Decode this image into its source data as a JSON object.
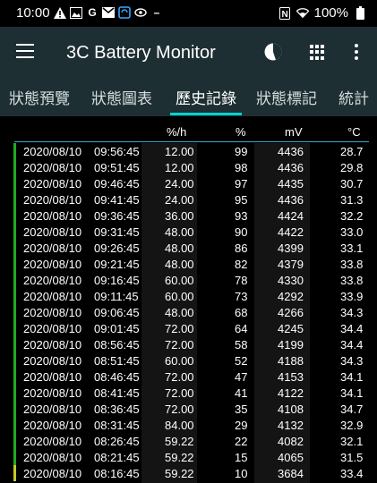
{
  "status_bar": {
    "time": "10:00",
    "battery": "100%",
    "left_icons": [
      "warning-icon",
      "image-icon",
      "google-icon",
      "gmail-icon",
      "sync-icon",
      "eye-icon",
      "dash-icon"
    ]
  },
  "app_bar": {
    "title": "3C Battery Monitor"
  },
  "tabs": [
    {
      "label": "狀態預覽",
      "active": false
    },
    {
      "label": "狀態圖表",
      "active": false
    },
    {
      "label": "歷史記錄",
      "active": true
    },
    {
      "label": "狀態標記",
      "active": false
    },
    {
      "label": "統計",
      "active": false
    }
  ],
  "table": {
    "headers": {
      "rate": "%/h",
      "pct": "%",
      "mv": "mV",
      "temp": "°C"
    },
    "rows": [
      {
        "date": "2020/08/10",
        "time": "09:56:45",
        "rate": "12.00",
        "pct": "99",
        "mv": "4436",
        "temp": "28.7",
        "status_color": "#1faa1f"
      },
      {
        "date": "2020/08/10",
        "time": "09:51:45",
        "rate": "12.00",
        "pct": "98",
        "mv": "4436",
        "temp": "29.8",
        "status_color": "#1faa1f"
      },
      {
        "date": "2020/08/10",
        "time": "09:46:45",
        "rate": "24.00",
        "pct": "97",
        "mv": "4435",
        "temp": "30.7",
        "status_color": "#1faa1f"
      },
      {
        "date": "2020/08/10",
        "time": "09:41:45",
        "rate": "24.00",
        "pct": "95",
        "mv": "4436",
        "temp": "31.3",
        "status_color": "#1faa1f"
      },
      {
        "date": "2020/08/10",
        "time": "09:36:45",
        "rate": "36.00",
        "pct": "93",
        "mv": "4424",
        "temp": "32.2",
        "status_color": "#1faa1f"
      },
      {
        "date": "2020/08/10",
        "time": "09:31:45",
        "rate": "48.00",
        "pct": "90",
        "mv": "4422",
        "temp": "33.0",
        "status_color": "#1faa1f"
      },
      {
        "date": "2020/08/10",
        "time": "09:26:45",
        "rate": "48.00",
        "pct": "86",
        "mv": "4399",
        "temp": "33.1",
        "status_color": "#1faa1f"
      },
      {
        "date": "2020/08/10",
        "time": "09:21:45",
        "rate": "48.00",
        "pct": "82",
        "mv": "4379",
        "temp": "33.8",
        "status_color": "#1faa1f"
      },
      {
        "date": "2020/08/10",
        "time": "09:16:45",
        "rate": "60.00",
        "pct": "78",
        "mv": "4330",
        "temp": "33.8",
        "status_color": "#1faa1f"
      },
      {
        "date": "2020/08/10",
        "time": "09:11:45",
        "rate": "60.00",
        "pct": "73",
        "mv": "4292",
        "temp": "33.9",
        "status_color": "#1faa1f"
      },
      {
        "date": "2020/08/10",
        "time": "09:06:45",
        "rate": "48.00",
        "pct": "68",
        "mv": "4266",
        "temp": "34.3",
        "status_color": "#1faa1f"
      },
      {
        "date": "2020/08/10",
        "time": "09:01:45",
        "rate": "72.00",
        "pct": "64",
        "mv": "4245",
        "temp": "34.4",
        "status_color": "#1faa1f"
      },
      {
        "date": "2020/08/10",
        "time": "08:56:45",
        "rate": "72.00",
        "pct": "58",
        "mv": "4199",
        "temp": "34.4",
        "status_color": "#1faa1f"
      },
      {
        "date": "2020/08/10",
        "time": "08:51:45",
        "rate": "60.00",
        "pct": "52",
        "mv": "4188",
        "temp": "34.3",
        "status_color": "#1faa1f"
      },
      {
        "date": "2020/08/10",
        "time": "08:46:45",
        "rate": "72.00",
        "pct": "47",
        "mv": "4153",
        "temp": "34.1",
        "status_color": "#1faa1f"
      },
      {
        "date": "2020/08/10",
        "time": "08:41:45",
        "rate": "72.00",
        "pct": "41",
        "mv": "4122",
        "temp": "34.1",
        "status_color": "#1faa1f"
      },
      {
        "date": "2020/08/10",
        "time": "08:36:45",
        "rate": "72.00",
        "pct": "35",
        "mv": "4108",
        "temp": "34.7",
        "status_color": "#1faa1f"
      },
      {
        "date": "2020/08/10",
        "time": "08:31:45",
        "rate": "84.00",
        "pct": "29",
        "mv": "4132",
        "temp": "32.9",
        "status_color": "#1faa1f"
      },
      {
        "date": "2020/08/10",
        "time": "08:26:45",
        "rate": "59.22",
        "pct": "22",
        "mv": "4082",
        "temp": "32.1",
        "status_color": "#1faa1f"
      },
      {
        "date": "2020/08/10",
        "time": "08:21:45",
        "rate": "59.22",
        "pct": "15",
        "mv": "4065",
        "temp": "31.5",
        "status_color": "#1faa1f"
      },
      {
        "date": "2020/08/10",
        "time": "08:16:45",
        "rate": "59.22",
        "pct": "10",
        "mv": "3684",
        "temp": "33.4",
        "status_color": "#c8c820"
      }
    ]
  }
}
